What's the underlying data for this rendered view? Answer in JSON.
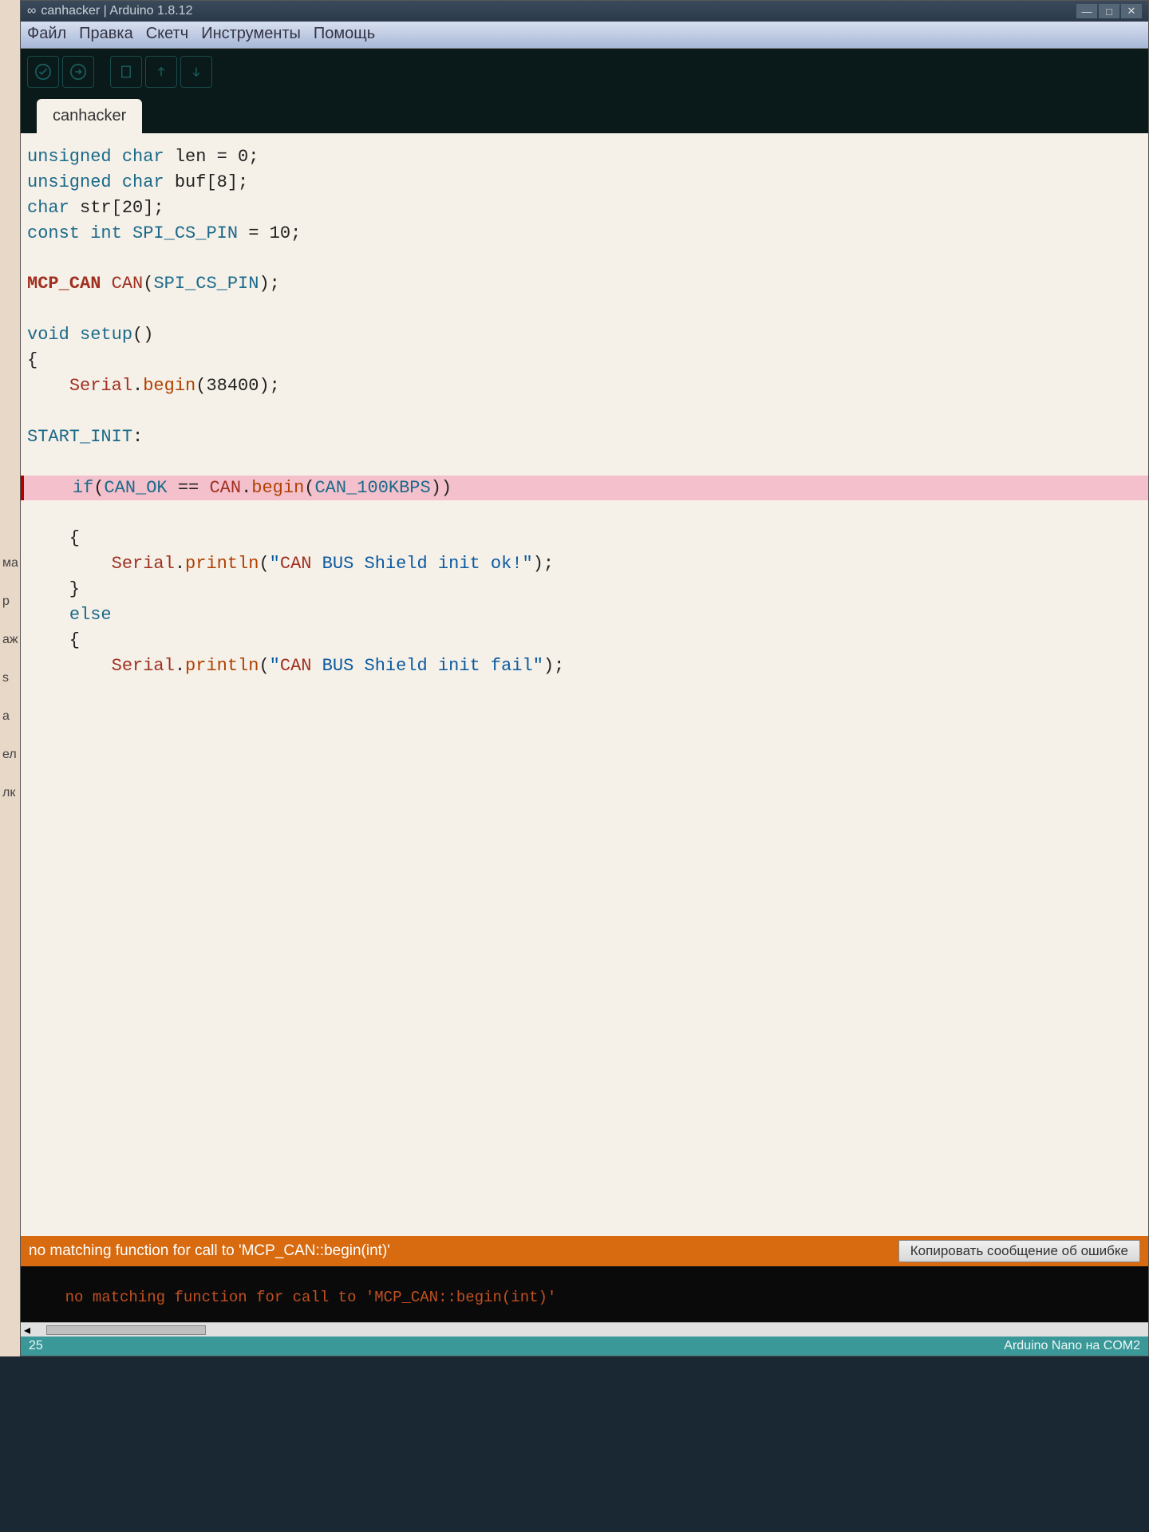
{
  "window": {
    "title": "canhacker | Arduino 1.8.12"
  },
  "menu": {
    "items": [
      "Файл",
      "Правка",
      "Скетч",
      "Инструменты",
      "Помощь"
    ]
  },
  "tab": {
    "name": "canhacker"
  },
  "code": {
    "lines": [
      {
        "raw": "unsigned char len = 0;"
      },
      {
        "raw": "unsigned char buf[8];"
      },
      {
        "raw": "char str[20];"
      },
      {
        "raw": "const int SPI_CS_PIN = 10;"
      },
      {
        "raw": ""
      },
      {
        "raw": "MCP_CAN CAN(SPI_CS_PIN);"
      },
      {
        "raw": ""
      },
      {
        "raw": "void setup()"
      },
      {
        "raw": "{"
      },
      {
        "raw": "    Serial.begin(38400);"
      },
      {
        "raw": ""
      },
      {
        "raw": "START_INIT:"
      },
      {
        "raw": ""
      },
      {
        "raw": "    if(CAN_OK == CAN.begin(CAN_100KBPS))",
        "error": true
      },
      {
        "raw": "    {"
      },
      {
        "raw": "        Serial.println(\"CAN BUS Shield init ok!\");"
      },
      {
        "raw": "    }"
      },
      {
        "raw": "    else"
      },
      {
        "raw": "    {"
      },
      {
        "raw": "        Serial.println(\"CAN BUS Shield init fail\");"
      }
    ]
  },
  "error": {
    "summary": "no matching function for call to 'MCP_CAN::begin(int)'",
    "copy_label": "Копировать сообщение об ошибке",
    "console": "no matching function for call to 'MCP_CAN::begin(int)'"
  },
  "status": {
    "line": "25",
    "board": "Arduino Nano на COM2"
  },
  "left_fragments": [
    "ма",
    "р",
    "аж",
    "s",
    "а",
    "ел",
    "лк"
  ]
}
